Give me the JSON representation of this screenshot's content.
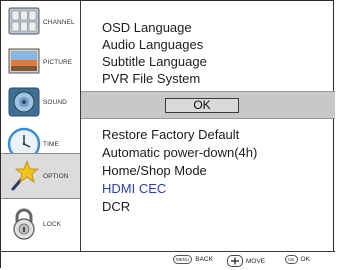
{
  "sidebar": {
    "items": [
      {
        "label": "CHANNEL",
        "icon": "channel-grid-icon"
      },
      {
        "label": "PICTURE",
        "icon": "picture-icon"
      },
      {
        "label": "SOUND",
        "icon": "speaker-icon"
      },
      {
        "label": "TIME",
        "icon": "clock-icon"
      },
      {
        "label": "OPTION",
        "icon": "star-wand-icon"
      },
      {
        "label": "LOCK",
        "icon": "padlock-icon"
      }
    ],
    "active": "OPTION"
  },
  "menu": {
    "top_items": [
      "OSD Language",
      "Audio Languages",
      "Subtitle Language",
      "PVR File System"
    ],
    "ok_label": "OK",
    "bottom_items": [
      "Restore Factory Default",
      "Automatic power-down(4h)",
      "Home/Shop Mode",
      "HDMI CEC",
      "DCR"
    ],
    "highlighted": "HDMI CEC"
  },
  "footer": {
    "back_key": "MENU",
    "back_label": "BACK",
    "move_label": "MOVE",
    "ok_key": "OK",
    "ok_label": "OK"
  },
  "colors": {
    "highlight_text": "#2b3fb0",
    "ok_bar": "#c8c8c8",
    "active_tab": "#dcdcdc"
  }
}
